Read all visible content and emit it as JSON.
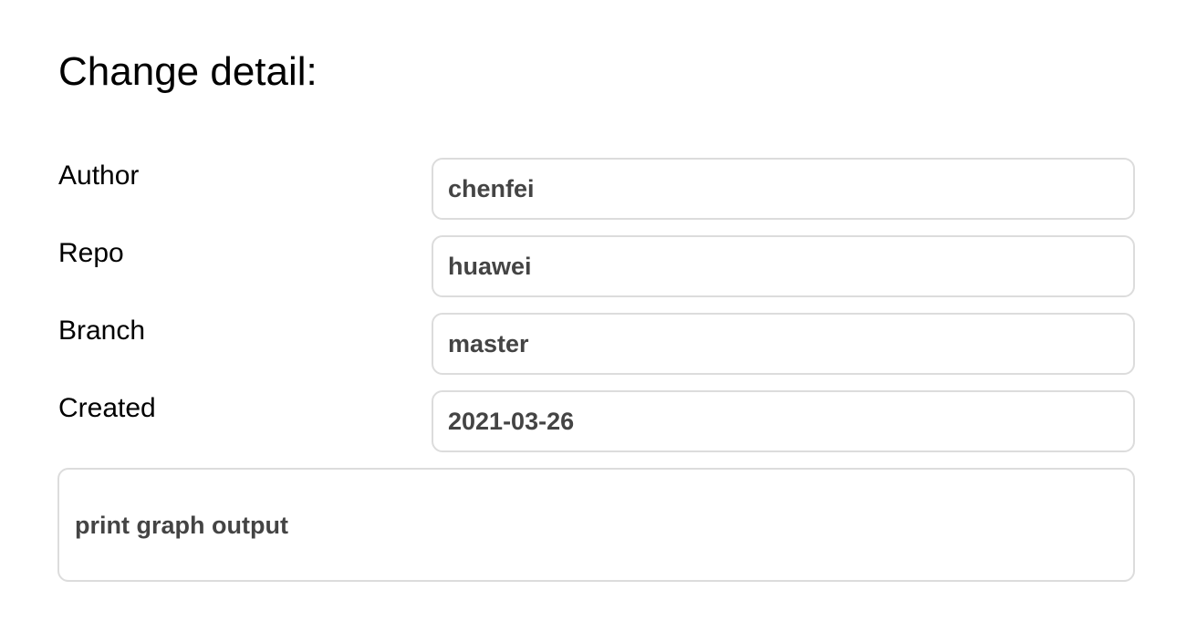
{
  "page": {
    "title": "Change detail:"
  },
  "fields": [
    {
      "label": "Author",
      "value": "chenfei"
    },
    {
      "label": "Repo",
      "value": "huawei"
    },
    {
      "label": "Branch",
      "value": "master"
    },
    {
      "label": "Created",
      "value": "2021-03-26"
    }
  ],
  "message": "print graph output",
  "colors": {
    "field_border": "#dcdcdc",
    "value_text": "#444444",
    "label_text": "#000000"
  }
}
